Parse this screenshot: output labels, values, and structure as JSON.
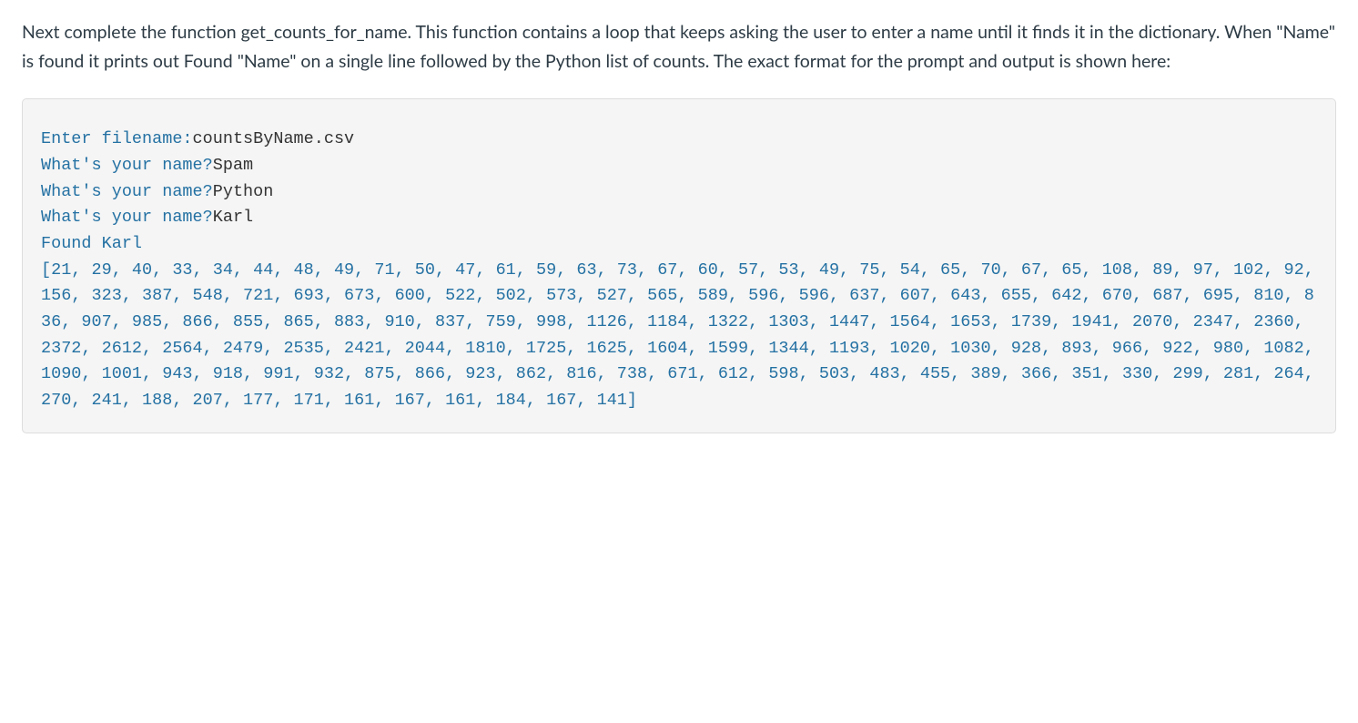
{
  "instruction": "Next complete the function get_counts_for_name.  This function contains a loop that keeps asking the user to enter a name until it finds it in the dictionary. When \"Name\" is found it prints out Found \"Name\" on a single line followed by the Python list of counts. The exact format for the prompt and output is shown here:",
  "terminal": {
    "line1_prompt": "Enter filename:",
    "line1_input": "countsByName.csv",
    "line2_prompt": "What's your name?",
    "line2_input": "Spam",
    "line3_prompt": "What's your name?",
    "line3_input": "Python",
    "line4_prompt": "What's your name?",
    "line4_input": "Karl",
    "line5_output": "Found Karl",
    "list_output": "[21, 29, 40, 33, 34, 44, 48, 49, 71, 50, 47, 61, 59, 63, 73, 67, 60, 57, 53, 49, 75, 54, 65, 70, 67, 65, 108, 89, 97, 102, 92, 156, 323, 387, 548, 721, 693, 673, 600, 522, 502, 573, 527, 565, 589, 596, 596, 637, 607, 643, 655, 642, 670, 687, 695, 810, 836, 907, 985, 866, 855, 865, 883, 910, 837, 759, 998, 1126, 1184, 1322, 1303, 1447, 1564, 1653, 1739, 1941, 2070, 2347, 2360, 2372, 2612, 2564, 2479, 2535, 2421, 2044, 1810, 1725, 1625, 1604, 1599, 1344, 1193, 1020, 1030, 928, 893, 966, 922, 980, 1082, 1090, 1001, 943, 918, 991, 932, 875, 866, 923, 862, 816, 738, 671, 612, 598, 503, 483, 455, 389, 366, 351, 330, 299, 281, 264, 270, 241, 188, 207, 177, 171, 161, 167, 161, 184, 167, 141]"
  }
}
